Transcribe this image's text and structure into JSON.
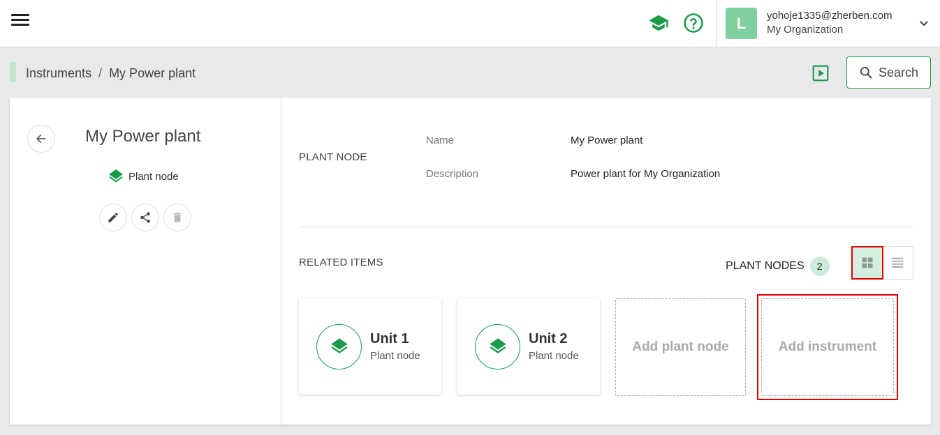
{
  "header": {
    "user_initial": "L",
    "user_email": "yohoje1335@zherben.com",
    "user_org": "My Organization"
  },
  "breadcrumb": {
    "items": [
      "Instruments",
      "My Power plant"
    ],
    "separator": "/"
  },
  "toolbar": {
    "search_label": "Search"
  },
  "node": {
    "title": "My Power plant",
    "type": "Plant node"
  },
  "details": {
    "section": "PLANT NODE",
    "fields": [
      {
        "label": "Name",
        "value": "My Power plant"
      },
      {
        "label": "Description",
        "value": "Power plant for My Organization"
      }
    ]
  },
  "related": {
    "label": "RELATED ITEMS",
    "plant_nodes_label": "PLANT NODES",
    "count": "2",
    "tiles": [
      {
        "name": "Unit 1",
        "type": "Plant node"
      },
      {
        "name": "Unit 2",
        "type": "Plant node"
      }
    ],
    "add_plant_node": "Add plant node",
    "add_instrument": "Add instrument"
  },
  "colors": {
    "accent": "#1a9b4b",
    "highlight": "#e00000",
    "avatar": "#7fcfa0"
  },
  "icons": [
    "menu-icon",
    "graduation-cap-icon",
    "help-icon",
    "chevron-down-icon",
    "play-icon",
    "search-icon",
    "arrow-left-icon",
    "layers-icon",
    "pencil-icon",
    "share-icon",
    "trash-icon",
    "grid-view-icon",
    "list-view-icon"
  ]
}
